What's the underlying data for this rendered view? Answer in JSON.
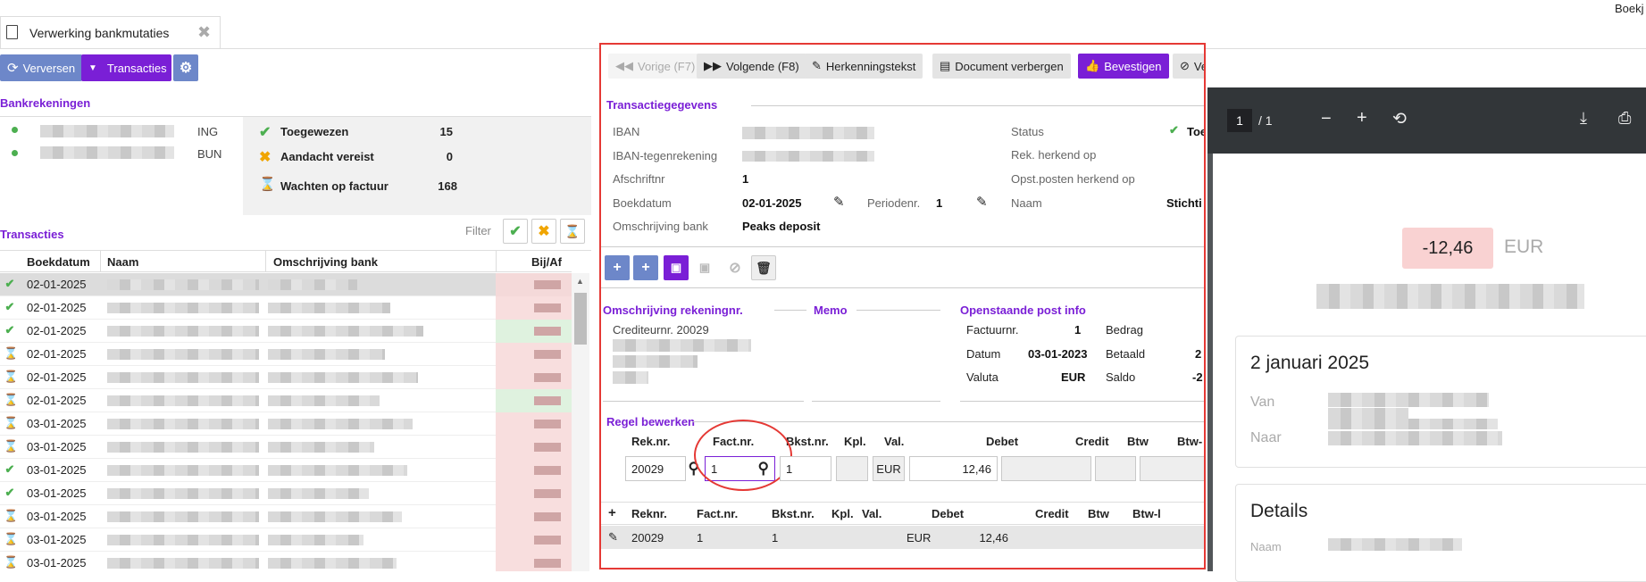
{
  "app": {
    "tab_title": "Verwerking bankmutaties",
    "top_right": "Boekj"
  },
  "toolbar": {
    "refresh": "Verversen",
    "transactions": "Transacties"
  },
  "bankrekeningen": {
    "title": "Bankrekeningen",
    "banks": [
      "ING",
      "BUN"
    ]
  },
  "summary": [
    {
      "label": "Toegewezen",
      "count": "15"
    },
    {
      "label": "Aandacht vereist",
      "count": "0"
    },
    {
      "label": "Wachten op factuur",
      "count": "168"
    }
  ],
  "transacties": {
    "title": "Transacties",
    "filter": "Filter",
    "columns": [
      "Boekdatum",
      "Naam",
      "Omschrijving bank",
      "Bij/Af"
    ],
    "rows": [
      {
        "status": "ok",
        "date": "02-01-2025"
      },
      {
        "status": "ok",
        "date": "02-01-2025"
      },
      {
        "status": "ok",
        "date": "02-01-2025"
      },
      {
        "status": "wait",
        "date": "02-01-2025"
      },
      {
        "status": "wait",
        "date": "02-01-2025"
      },
      {
        "status": "wait",
        "date": "02-01-2025"
      },
      {
        "status": "wait",
        "date": "03-01-2025"
      },
      {
        "status": "wait",
        "date": "03-01-2025"
      },
      {
        "status": "ok",
        "date": "03-01-2025"
      },
      {
        "status": "ok",
        "date": "03-01-2025"
      },
      {
        "status": "wait",
        "date": "03-01-2025"
      },
      {
        "status": "wait",
        "date": "03-01-2025"
      },
      {
        "status": "wait",
        "date": "03-01-2025"
      }
    ]
  },
  "detail_toolbar": {
    "prev": "Vorige (F7)",
    "next": "Volgende (F8)",
    "recog": "Herkenningstekst",
    "hide_doc": "Document verbergen",
    "confirm": "Bevestigen",
    "delete": "Verwijderen"
  },
  "transactiegegevens": {
    "title": "Transactiegegevens",
    "iban": "IBAN",
    "iban_tegen": "IBAN-tegenrekening",
    "afschriftnr_label": "Afschriftnr",
    "afschriftnr": "1",
    "boekdatum_label": "Boekdatum",
    "boekdatum": "02-01-2025",
    "periodenr_label": "Periodenr.",
    "periodenr": "1",
    "omschrijving_label": "Omschrijving bank",
    "omschrijving": "Peaks deposit",
    "status_label": "Status",
    "status_value": "Toe",
    "rek_herkend": "Rek. herkend op",
    "opst_herkend": "Opst.posten herkend op",
    "naam_label": "Naam",
    "naam_value": "Stichti"
  },
  "omschrijving_rek": {
    "title": "Omschrijving rekeningnr.",
    "crediteur": "Crediteurnr. 20029"
  },
  "memo": {
    "title": "Memo"
  },
  "openstaande": {
    "title": "Openstaande post info",
    "factuurnr_label": "Factuurnr.",
    "factuurnr": "1",
    "datum_label": "Datum",
    "datum": "03-01-2023",
    "valuta_label": "Valuta",
    "valuta": "EUR",
    "bedrag": "Bedrag",
    "betaald": "Betaald",
    "betaald_val": "2",
    "saldo": "Saldo",
    "saldo_val": "-2"
  },
  "regel": {
    "title": "Regel bewerken",
    "headers": [
      "Rek.nr.",
      "Fact.nr.",
      "Bkst.nr.",
      "Kpl.",
      "Val.",
      "Debet",
      "Credit",
      "Btw",
      "Btw-"
    ],
    "rek": "20029",
    "fact": "1",
    "bkst": "1",
    "val": "EUR",
    "debet": "12,46"
  },
  "lines": {
    "headers": [
      "Reknr.",
      "Fact.nr.",
      "Bkst.nr.",
      "Kpl.",
      "Val.",
      "Debet",
      "Credit",
      "Btw",
      "Btw-l"
    ],
    "rows": [
      {
        "rek": "20029",
        "fact": "1",
        "bkst": "1",
        "val": "EUR",
        "debet": "12,46"
      }
    ]
  },
  "pdf": {
    "page": "1",
    "total": "/ 1",
    "amount": "-12,46",
    "currency": "EUR",
    "date_title": "2 januari 2025",
    "van": "Van",
    "naar": "Naar",
    "details": "Details",
    "naam": "Naam"
  }
}
